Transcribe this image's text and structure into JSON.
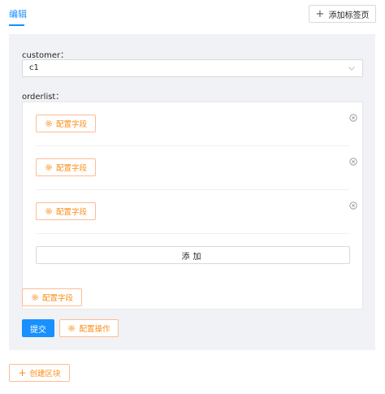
{
  "tabs": {
    "active_label": "编辑",
    "add_tab_label": "添加标签页"
  },
  "form": {
    "customer_label": "customer：",
    "customer_value": "c1",
    "orderlist_label": "orderlist：",
    "row_config_label": "配置字段",
    "add_item_label": "添加",
    "config_fields_label": "配置字段",
    "submit_label": "提交",
    "config_actions_label": "配置操作"
  },
  "footer": {
    "create_block_label": "创建区块"
  },
  "colors": {
    "primary": "#1890ff",
    "accent_orange": "#fa8c16",
    "panel_bg": "#f0f2f5"
  },
  "icons": [
    "plus-icon",
    "chevron-down-icon",
    "gear-icon",
    "close-circle-icon"
  ]
}
